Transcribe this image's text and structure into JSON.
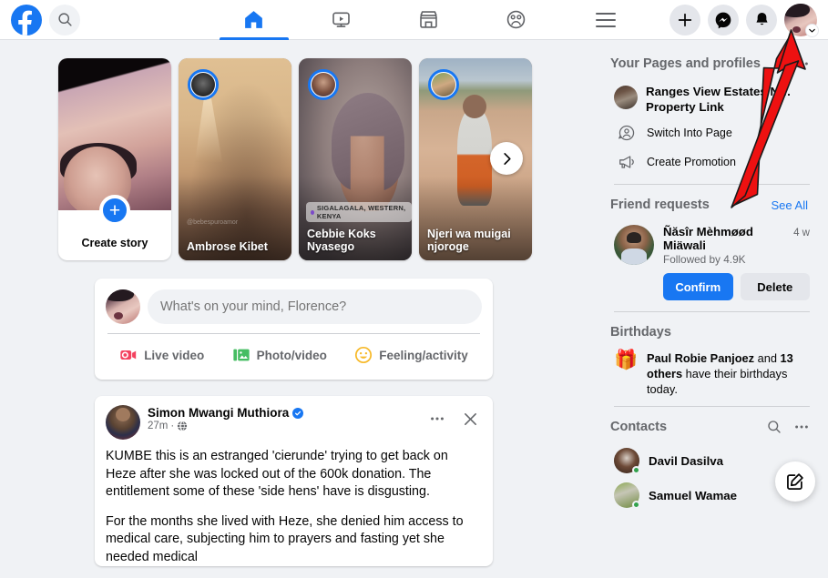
{
  "header": {
    "logo": "facebook-logo",
    "search_icon": "search-icon",
    "nav_tabs": [
      {
        "label": "Home",
        "icon": "home-icon",
        "active": true
      },
      {
        "label": "Video",
        "icon": "video-icon",
        "active": false
      },
      {
        "label": "Marketplace",
        "icon": "marketplace-icon",
        "active": false
      },
      {
        "label": "Groups",
        "icon": "groups-icon",
        "active": false
      }
    ],
    "menu_icon": "hamburger-menu-icon",
    "right_buttons": [
      {
        "name": "create-button",
        "icon": "plus-icon"
      },
      {
        "name": "messenger-button",
        "icon": "messenger-icon"
      },
      {
        "name": "notifications-button",
        "icon": "bell-icon"
      }
    ],
    "account_chevron": "chevron-down-icon"
  },
  "stories": {
    "create": {
      "label": "Create story",
      "plus_icon": "plus-icon"
    },
    "items": [
      {
        "name": "Ambrose Kibet",
        "watermark": "@bebespuroamor",
        "location": null
      },
      {
        "name": "Cebbie Koks Nyasego",
        "watermark": null,
        "location": "SIGALAGALA, WESTERN, KENYA"
      },
      {
        "name": "Njeri wa muigai njoroge",
        "watermark": null,
        "location": null
      }
    ],
    "next_icon": "chevron-right-icon"
  },
  "composer": {
    "placeholder": "What's on your mind, Florence?",
    "actions": [
      {
        "label": "Live video",
        "icon": "live-video-icon",
        "color": "#f3425f"
      },
      {
        "label": "Photo/video",
        "icon": "photo-video-icon",
        "color": "#45bd62"
      },
      {
        "label": "Feeling/activity",
        "icon": "feeling-activity-icon",
        "color": "#f7b928"
      }
    ]
  },
  "post": {
    "author": "Simon Mwangi Muthiora",
    "verified_icon": "verified-badge-icon",
    "time": "27m",
    "separator": "·",
    "audience_icon": "globe-icon",
    "more_icon": "more-options-icon",
    "close_icon": "close-icon",
    "paragraphs": [
      "KUMBE this is an estranged 'cierunde' trying to get back on Heze after she was locked out of the 600k donation. The entitlement some of these 'side hens' have is disgusting.",
      "For the months she lived with Heze, she denied him access to medical care, subjecting him to prayers and fasting yet she needed medical"
    ]
  },
  "sidebar": {
    "pages": {
      "title": "Your Pages and profiles",
      "more_icon": "more-options-icon",
      "page_name": "Ranges View Estates N… Property Link",
      "links": [
        {
          "label": "Switch Into Page",
          "icon": "switch-account-icon"
        },
        {
          "label": "Create Promotion",
          "icon": "megaphone-icon"
        }
      ]
    },
    "friend_requests": {
      "title": "Friend requests",
      "see_all": "See All",
      "request": {
        "name": "Ñăsîr Mèhmøød Miäwali",
        "time": "4 w",
        "meta": "Followed by 4.9K",
        "confirm": "Confirm",
        "delete": "Delete"
      }
    },
    "birthdays": {
      "title": "Birthdays",
      "icon": "gift-icon",
      "name": "Paul Robie Panjoez",
      "and": " and ",
      "others": "13 others",
      "tail": "have their birthdays today."
    },
    "contacts": {
      "title": "Contacts",
      "search_icon": "search-icon",
      "more_icon": "more-options-icon",
      "items": [
        {
          "name": "Davil Dasilva",
          "online": true
        },
        {
          "name": "Samuel Wamae",
          "online": true
        }
      ]
    },
    "fab": {
      "icon": "new-message-icon"
    }
  },
  "annotation": {
    "arrow_color": "#ee1111",
    "target": "profile-avatar"
  },
  "theme": {
    "accent": "#1877f2",
    "page_bg": "#f0f2f5",
    "card_bg": "#ffffff",
    "text": "#050505",
    "muted": "#65676b"
  }
}
